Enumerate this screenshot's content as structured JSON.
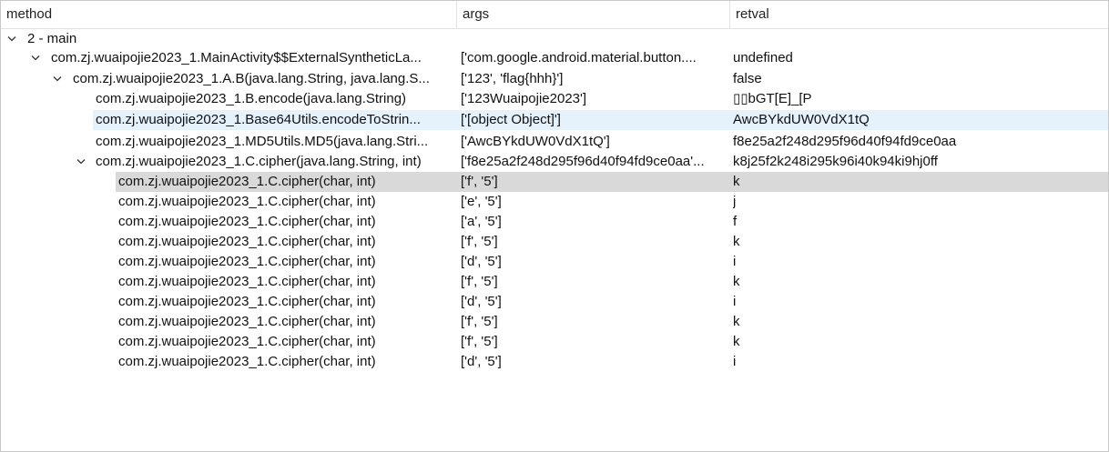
{
  "columns": {
    "method": "method",
    "args": "args",
    "retval": "retval"
  },
  "colors": {
    "selected_row": "#d9d9d9",
    "hover_row": "#e5f1fb",
    "header_border": "#e2e2e2"
  },
  "rows": [
    {
      "method": "2 - main",
      "args": "",
      "retval": "",
      "expanded": true
    },
    {
      "method": "com.zj.wuaipojie2023_1.MainActivity$$ExternalSyntheticLa...",
      "args": "['com.google.android.material.button....",
      "retval": "undefined",
      "expanded": true
    },
    {
      "method": "com.zj.wuaipojie2023_1.A.B(java.lang.String, java.lang.S...",
      "args": "['123', 'flag{hhh}']",
      "retval": "false",
      "expanded": true
    },
    {
      "method": "com.zj.wuaipojie2023_1.B.encode(java.lang.String)",
      "args": "['123Wuaipojie2023']",
      "retval": "▯▯bGT[E]_[P",
      "expanded": false
    },
    {
      "method": "com.zj.wuaipojie2023_1.Base64Utils.encodeToStrin...",
      "args": "['[object Object]']",
      "retval": "AwcBYkdUW0VdX1tQ",
      "expanded": false
    },
    {
      "method": "com.zj.wuaipojie2023_1.MD5Utils.MD5(java.lang.Stri...",
      "args": "['AwcBYkdUW0VdX1tQ']",
      "retval": "f8e25a2f248d295f96d40f94fd9ce0aa",
      "expanded": false
    },
    {
      "method": "com.zj.wuaipojie2023_1.C.cipher(java.lang.String, int)",
      "args": "['f8e25a2f248d295f96d40f94fd9ce0aa'...",
      "retval": "k8j25f2k248i295k96i40k94ki9hj0ff",
      "expanded": true
    },
    {
      "method": "com.zj.wuaipojie2023_1.C.cipher(char, int)",
      "args": "['f', '5']",
      "retval": "k",
      "expanded": false
    },
    {
      "method": "com.zj.wuaipojie2023_1.C.cipher(char, int)",
      "args": "['e', '5']",
      "retval": "j",
      "expanded": false
    },
    {
      "method": "com.zj.wuaipojie2023_1.C.cipher(char, int)",
      "args": "['a', '5']",
      "retval": "f",
      "expanded": false
    },
    {
      "method": "com.zj.wuaipojie2023_1.C.cipher(char, int)",
      "args": "['f', '5']",
      "retval": "k",
      "expanded": false
    },
    {
      "method": "com.zj.wuaipojie2023_1.C.cipher(char, int)",
      "args": "['d', '5']",
      "retval": "i",
      "expanded": false
    },
    {
      "method": "com.zj.wuaipojie2023_1.C.cipher(char, int)",
      "args": "['f', '5']",
      "retval": "k",
      "expanded": false
    },
    {
      "method": "com.zj.wuaipojie2023_1.C.cipher(char, int)",
      "args": "['d', '5']",
      "retval": "i",
      "expanded": false
    },
    {
      "method": "com.zj.wuaipojie2023_1.C.cipher(char, int)",
      "args": "['f', '5']",
      "retval": "k",
      "expanded": false
    },
    {
      "method": "com.zj.wuaipojie2023_1.C.cipher(char, int)",
      "args": "['f', '5']",
      "retval": "k",
      "expanded": false
    },
    {
      "method": "com.zj.wuaipojie2023_1.C.cipher(char, int)",
      "args": "['d', '5']",
      "retval": "i",
      "expanded": false
    }
  ]
}
